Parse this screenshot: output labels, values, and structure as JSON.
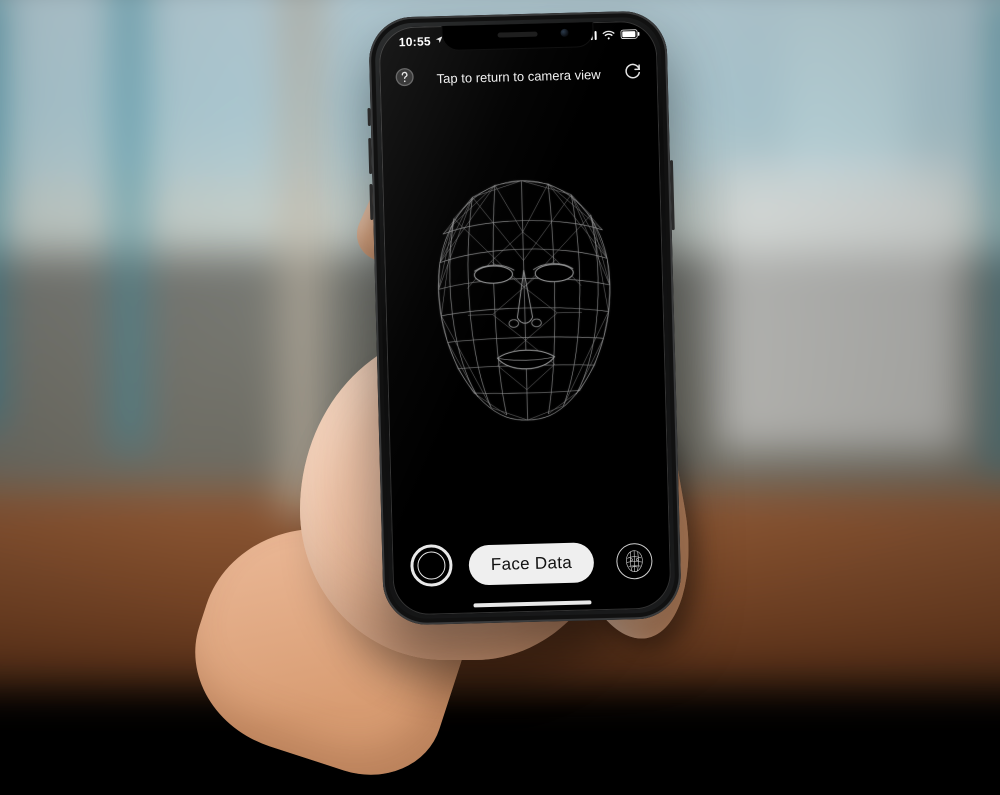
{
  "status_bar": {
    "time": "10:55",
    "location_icon": "location-arrow",
    "signal_bars": 4,
    "wifi_icon": "wifi",
    "battery_icon": "battery"
  },
  "top_toolbar": {
    "help_icon": "help-circle",
    "title": "Tap to return to camera view",
    "refresh_icon": "refresh"
  },
  "main": {
    "content": "face-wireframe-mesh"
  },
  "bottom_toolbar": {
    "shutter_icon": "shutter-ring",
    "face_data_label": "Face Data",
    "mesh_toggle_icon": "face-mesh-outline"
  },
  "colors": {
    "screen_bg": "#000000",
    "ui_text": "#f0f0f0",
    "pill_bg": "#efefef",
    "pill_text": "#111111",
    "mesh_stroke": "#bfc0c1"
  }
}
